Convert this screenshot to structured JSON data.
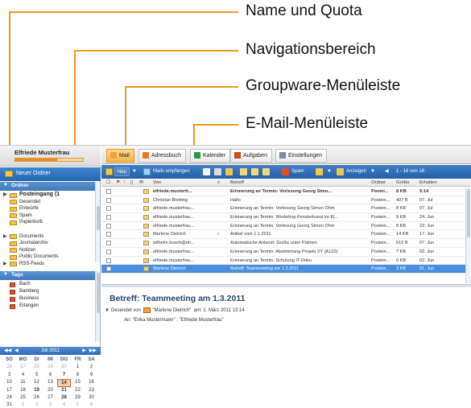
{
  "callouts": {
    "name_quota": "Name und Quota",
    "navigation": "Navigationsbereich",
    "groupware_menu": "Groupware-Menüleiste",
    "email_menu": "E-Mail-Menüleiste"
  },
  "colors": {
    "callout": "#ee9a1e",
    "toolbar_blue": "#2f6db5",
    "active_tab": "#f4b548"
  },
  "user": {
    "name": "Elfriede Musterfrau",
    "quota_fraction": 0.62
  },
  "sidebar": {
    "new_folder_label": "Neuer Ordner",
    "folders_heading": "Ordner",
    "folders": [
      {
        "label": "Posteingang (1",
        "bold": true,
        "twisty": "▶"
      },
      {
        "label": "Gesendet"
      },
      {
        "label": "Entwürfe"
      },
      {
        "label": "Spam"
      },
      {
        "label": "Papierkorb"
      },
      {
        "label": "",
        "spacer": true
      },
      {
        "label": "Documents",
        "twisty": "▶"
      },
      {
        "label": "Journalarchiv"
      },
      {
        "label": "Notizen"
      },
      {
        "label": "Public Documents"
      },
      {
        "label": "RSS-Feeds",
        "twisty": "▶"
      }
    ],
    "tags_heading": "Tags",
    "tags": [
      "Bach",
      "Bamberg",
      "Business",
      "Erlangen"
    ]
  },
  "calendar": {
    "month_label": "Juli 2011",
    "weekday_headers": [
      "SO",
      "MO",
      "DI",
      "MI",
      "DO",
      "FR",
      "SA"
    ],
    "weeks": [
      [
        "26",
        "27",
        "28",
        "29",
        "30",
        "1",
        "2"
      ],
      [
        "3",
        "4",
        "5",
        "6",
        "7",
        "8",
        "9"
      ],
      [
        "10",
        "11",
        "12",
        "13",
        "14",
        "15",
        "16"
      ],
      [
        "17",
        "18",
        "19",
        "20",
        "21",
        "22",
        "23"
      ],
      [
        "24",
        "25",
        "26",
        "27",
        "28",
        "29",
        "30"
      ],
      [
        "31",
        "1",
        "2",
        "3",
        "4",
        "5",
        "6"
      ]
    ],
    "today": "14"
  },
  "tabs": [
    {
      "label": "Mail",
      "active": true,
      "icon": "mail-icon"
    },
    {
      "label": "Adressbuch",
      "icon": "addressbook-icon"
    },
    {
      "label": "Kalender",
      "icon": "calendar-icon"
    },
    {
      "label": "Aufgaben",
      "icon": "tasks-icon"
    },
    {
      "label": "Einstellungen",
      "icon": "settings-icon"
    }
  ],
  "mailbar": {
    "new_label": "Neu",
    "receive_label": "Mails empfangen",
    "spam_label": "Spam",
    "view_label": "Anzeigen",
    "page_info": "1 - 16 von 16"
  },
  "list_headers": {
    "from": "Von",
    "subject": "Betreff",
    "folder": "Ordner",
    "size": "Größe",
    "received": "Erhalten"
  },
  "emails": [
    {
      "from": "elfriede.musterfr...",
      "subject": "Erinnerung an Termin: Vorlesung Georg Simo...",
      "folder": "Postei...",
      "size": "8 KB",
      "date": "9:14",
      "unread": true
    },
    {
      "from": "Christian Bretting",
      "subject": "Hallo",
      "folder": "Postein...",
      "size": "407 B",
      "date": "07. Jul"
    },
    {
      "from": "elfriede.musterfrau...",
      "subject": "Erinnerung an Termin: Vorlesung Georg Simon Ohm",
      "folder": "Postein...",
      "size": "8 KB",
      "date": "07. Jul"
    },
    {
      "from": "elfriede.musterfrau...",
      "subject": "Erinnerung an Termin: Workshop Fensterkunst im Kl...",
      "folder": "Postein...",
      "size": "9 KB",
      "date": "24. Jun"
    },
    {
      "from": "elfriede.musterfrau...",
      "subject": "Erinnerung an Termin: Vorlesung Georg Simon Ohm",
      "folder": "Postein...",
      "size": "8 KB",
      "date": "23. Jun"
    },
    {
      "from": "Marlene Dietrich",
      "subject": "Artikel vom 1.1.2011",
      "folder": "Postein...",
      "size": "14 KB",
      "date": "17. Jun",
      "attachment": true
    },
    {
      "from": "wilhelm.busch@oh...",
      "subject": "Automatische Antwort: Grüße unter Palmen",
      "folder": "Postein...",
      "size": "610 B",
      "date": "07. Jun"
    },
    {
      "from": "elfriede.musterfrau...",
      "subject": "Erinnerung an Termin: Abstimmung Projekt XY (A122)",
      "folder": "Postein...",
      "size": "7 KB",
      "date": "02. Jun"
    },
    {
      "from": "elfriede.musterfrau...",
      "subject": "Erinnerung an Termin: Schulung IT-Doku",
      "folder": "Postein...",
      "size": "6 KB",
      "date": "02. Jun"
    },
    {
      "from": "Marlene Dietrich",
      "subject": "Betreff: Teammeeting am 1.3.2011",
      "folder": "Postein...",
      "size": "3 KB",
      "date": "01. Jun",
      "selected": true
    }
  ],
  "preview": {
    "subject": "Betreff: Teammeeting am 1.3.2011",
    "sent_by_label": "Gesendet von",
    "sender": "\"Marlene Dietrich\"",
    "date_text": "am: 1. März 2011 13:14",
    "to_label": "An:",
    "to_text": "\"Erika Mustermann\" ; \"Elfriede Musterfrau\""
  }
}
